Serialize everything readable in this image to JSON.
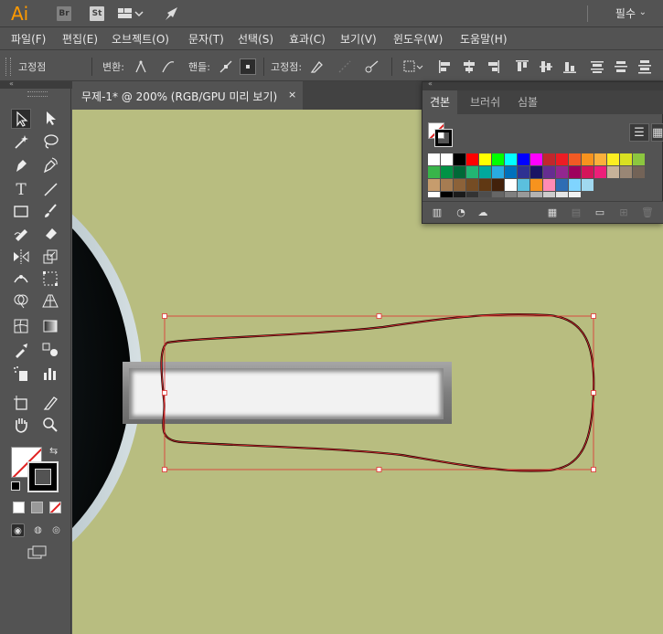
{
  "appbar": {
    "logo": "Ai",
    "bridge_label": "Br",
    "stock_label": "St",
    "layout_icon": "layout-grid-icon",
    "publish_icon": "rocket-icon",
    "workspace": "필수",
    "workspace_arrow": "⌄"
  },
  "menu": {
    "items": [
      "파일(F)",
      "편집(E)",
      "오브젝트(O)",
      "문자(T)",
      "선택(S)",
      "효과(C)",
      "보기(V)",
      "윈도우(W)",
      "도움말(H)"
    ]
  },
  "control": {
    "anchor_label": "고정점",
    "convert_label": "변환:",
    "handle_label": "핸들:",
    "anchor_points_label": "고정점:"
  },
  "document": {
    "tab_title": "무제-1* @ 200% (RGB/GPU 미리 보기)",
    "close": "×"
  },
  "swatches_panel": {
    "tabs": [
      "견본",
      "브러쉬",
      "심볼"
    ],
    "active_tab": 0,
    "rows": [
      [
        "#ffffff",
        "#ffffff",
        "#000000",
        "#ff0000",
        "#ffff00",
        "#00ff00",
        "#00ffff",
        "#0000ff",
        "#ff00ff",
        "#c1272d",
        "#ed1c24",
        "#f15a24",
        "#f7931e",
        "#fbb03b",
        "#fcee21",
        "#d9e021",
        "#8cc63f"
      ],
      [
        "#39b54a",
        "#009245",
        "#006837",
        "#22b573",
        "#00a99d",
        "#29abe2",
        "#0071bc",
        "#2e3192",
        "#1b1464",
        "#662d91",
        "#93278f",
        "#9e005d",
        "#d4145a",
        "#ed1e79",
        "#c7b299",
        "#998675",
        "#736357"
      ],
      [
        "#c69c6d",
        "#a67c52",
        "#8c6239",
        "#754c24",
        "#603813",
        "#42210b",
        "#ffffff",
        "#5bc0de",
        "#f7931e",
        "#ff8bb5",
        "#2e6db4",
        "#7fd4ff",
        "#a0d8ef"
      ],
      [
        "#ffffff",
        "#000000",
        "#1a1a1a",
        "#333333",
        "#4d4d4d",
        "#666666",
        "#808080",
        "#999999",
        "#b3b3b3",
        "#cccccc",
        "#e6e6e6",
        "#f2f2f2"
      ]
    ]
  },
  "canvas": {
    "background": "#b8bd80",
    "selection_color": "#e03030"
  }
}
